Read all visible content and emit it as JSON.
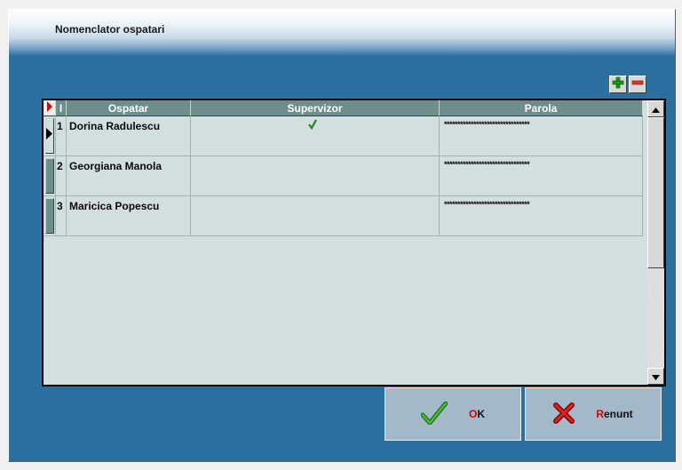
{
  "window": {
    "title": "Nomenclator ospatari"
  },
  "toolbar": {
    "add": "add-icon",
    "remove": "remove-icon"
  },
  "grid": {
    "columns": [
      {
        "key": "id",
        "label": "I"
      },
      {
        "key": "ospatar",
        "label": "Ospatar"
      },
      {
        "key": "supervizor",
        "label": "Supervizor"
      },
      {
        "key": "parola",
        "label": "Parola"
      }
    ],
    "rows": [
      {
        "id": "1",
        "ospatar": "Dorina Radulescu",
        "supervizor": true,
        "parola": "********************************"
      },
      {
        "id": "2",
        "ospatar": "Georgiana Manola",
        "supervizor": false,
        "parola": "********************************"
      },
      {
        "id": "3",
        "ospatar": "Maricica Popescu",
        "supervizor": false,
        "parola": "********************************"
      }
    ],
    "current_row": 1
  },
  "buttons": {
    "ok": {
      "accel": "O",
      "rest": "K"
    },
    "cancel": {
      "accel": "R",
      "rest": "enunt"
    }
  },
  "colors": {
    "window_bg": "#2b6f9e",
    "grid_bg": "#d3dede",
    "header_bg": "#6e8e8e",
    "accent_red": "#e00000",
    "check_green": "#1a8a1a"
  }
}
